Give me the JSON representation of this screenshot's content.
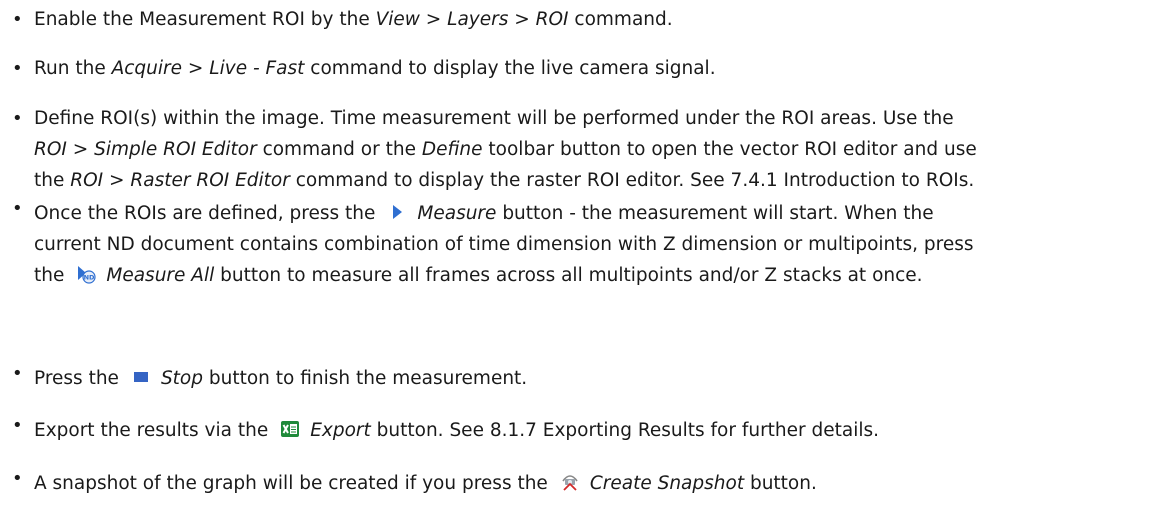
{
  "bullet": "•",
  "items": [
    {
      "parts": [
        "Enable the Measurement ROI by the ",
        "View > Layers > ROI",
        " command."
      ]
    },
    {
      "parts": [
        "Run the ",
        "Acquire > Live - Fast",
        " command to display the live camera signal."
      ]
    },
    {
      "lines": [
        [
          "Define ROI(s) within the image. Time measurement will be performed under the ROI areas. Use the"
        ],
        [
          "ROI > Simple ROI Editor",
          " command or the ",
          "Define",
          " toolbar button to open the vector ROI editor and use"
        ],
        [
          "the ",
          "ROI > Raster ROI Editor",
          " command to display the raster ROI editor. See 7.4.1 Introduction to ROIs."
        ]
      ]
    },
    {
      "lines": [
        [
          "Once the ROIs are defined, press the",
          "Measure",
          " button - the measurement will start. When the"
        ],
        [
          "current ND document contains combination of time dimension with Z dimension or multipoints, press"
        ],
        [
          "the",
          "Measure All",
          " button to measure all frames across all multipoints and/or Z stacks at once."
        ]
      ],
      "icons": [
        "play-icon",
        "measure-all-nd-icon"
      ]
    },
    {
      "parts": [
        "Press the",
        "Stop",
        " button to finish the measurement."
      ],
      "icon": "stop-icon"
    },
    {
      "parts": [
        "Export the results via the",
        "Export",
        " button. See 8.1.7 Exporting Results for further details."
      ],
      "icon": "excel-export-icon"
    },
    {
      "parts": [
        "A snapshot of the graph will be created if you press the",
        "Create Snapshot",
        " button."
      ],
      "icon": "camera-snapshot-icon"
    }
  ],
  "colors": {
    "text": "#1a1a1a",
    "icon_blue": "#2f6fd1",
    "stop_blue": "#3564c4",
    "excel_green": "#1f8a3a",
    "snapshot_red": "#d22a2a"
  }
}
